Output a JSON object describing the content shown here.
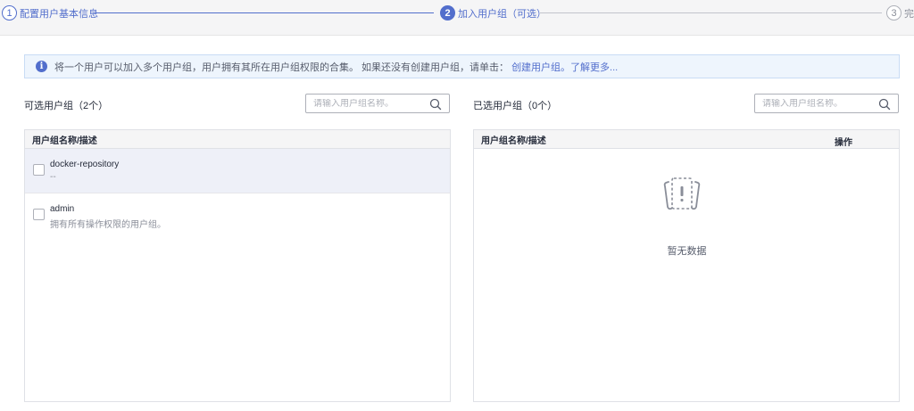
{
  "stepper": {
    "steps": [
      {
        "number": "1",
        "label": "配置用户基本信息",
        "state": "done"
      },
      {
        "number": "2",
        "label": "加入用户组（可选）",
        "state": "active"
      },
      {
        "number": "3",
        "label": "完",
        "state": "todo"
      }
    ]
  },
  "banner": {
    "icon": "info-icon",
    "text": "将一个用户可以加入多个用户组，用户拥有其所在用户组权限的合集。 如果还没有创建用户组，请单击：",
    "link_create": "创建用户组。",
    "link_more": "了解更多..."
  },
  "left_panel": {
    "title": "可选用户组（2个）",
    "search_placeholder": "请输入用户组名称。",
    "column_header": "用户组名称/描述",
    "rows": [
      {
        "name": "docker-repository",
        "desc": "--"
      },
      {
        "name": "admin",
        "desc": "拥有所有操作权限的用户组。"
      }
    ]
  },
  "right_panel": {
    "title": "已选用户组（0个）",
    "search_placeholder": "请输入用户组名称。",
    "column_header": "用户组名称/描述",
    "column_action": "操作",
    "empty_text": "暂无数据"
  },
  "colors": {
    "accent": "#526ecc",
    "banner_bg": "#eef5fd",
    "header_bg": "#f5f5f6"
  }
}
